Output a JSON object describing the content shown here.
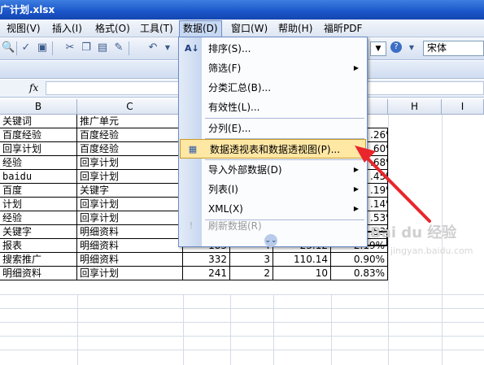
{
  "window": {
    "title": "广计划.xlsx"
  },
  "menubar": {
    "items": [
      {
        "label": "视图(V)",
        "name": "view"
      },
      {
        "label": "插入(I)",
        "name": "insert"
      },
      {
        "label": "格式(O)",
        "name": "format"
      },
      {
        "label": "工具(T)",
        "name": "tools"
      },
      {
        "label": "数据(D)",
        "name": "data"
      },
      {
        "label": "窗口(W)",
        "name": "window"
      },
      {
        "label": "帮助(H)",
        "name": "help"
      },
      {
        "label": "福昕PDF",
        "name": "foxit-pdf"
      }
    ]
  },
  "toolbar": {
    "font_name": "宋体"
  },
  "formula_bar": {
    "fx": "fx"
  },
  "sheet": {
    "columns": [
      "B",
      "C",
      "",
      "",
      "",
      "",
      "H",
      "I"
    ],
    "rows": [
      {
        "b": "关键词",
        "c": "推广单元",
        "d": "",
        "e": "",
        "f": "",
        "g": ""
      },
      {
        "b": "百度经验",
        "c": "百度经验",
        "d": "",
        "e": "",
        "f": "",
        "g": ".26%"
      },
      {
        "b": "回享计划",
        "c": "百度经验",
        "d": "",
        "e": "",
        "f": "",
        "g": ".60%"
      },
      {
        "b": "经验",
        "c": "回享计划",
        "d": "",
        "e": "",
        "f": "",
        "g": ".68%"
      },
      {
        "b": "baidu",
        "c": "回享计划",
        "d": "",
        "e": "",
        "f": "",
        "g": ".45%"
      },
      {
        "b": "百度",
        "c": "关键字",
        "d": "",
        "e": "",
        "f": "",
        "g": ".19%"
      },
      {
        "b": "计划",
        "c": "回享计划",
        "d": "",
        "e": "",
        "f": "",
        "g": ".14%"
      },
      {
        "b": "经验",
        "c": "回享计划",
        "d": "",
        "e": "",
        "f": "",
        "g": ".53%"
      },
      {
        "b": "关键字",
        "c": "明细资料",
        "d": "",
        "e": "",
        "f": "",
        "g": ".53%"
      },
      {
        "b": "报表",
        "c": "明细资料",
        "d": "183",
        "e": "4",
        "f": "23.12",
        "g": "2.19%"
      },
      {
        "b": "搜索推广",
        "c": "明细资料",
        "d": "332",
        "e": "3",
        "f": "110.14",
        "g": "0.90%"
      },
      {
        "b": "明细资料",
        "c": "回享计划",
        "d": "241",
        "e": "2",
        "f": "10",
        "g": "0.83%"
      }
    ]
  },
  "data_menu": {
    "items": [
      {
        "label": "排序(S)...",
        "has_submenu": false,
        "icon": "sort-az-icon"
      },
      {
        "label": "筛选(F)",
        "has_submenu": true,
        "icon": ""
      },
      {
        "label": "分类汇总(B)...",
        "has_submenu": false,
        "icon": ""
      },
      {
        "label": "有效性(L)...",
        "has_submenu": false,
        "icon": ""
      },
      {
        "label": "分列(E)...",
        "has_submenu": false,
        "icon": ""
      },
      {
        "label": "数据透视表和数据透视图(P)...",
        "has_submenu": false,
        "icon": "pivot-table-icon",
        "highlighted": true
      },
      {
        "label": "导入外部数据(D)",
        "has_submenu": true,
        "icon": ""
      },
      {
        "label": "列表(I)",
        "has_submenu": true,
        "icon": ""
      },
      {
        "label": "XML(X)",
        "has_submenu": true,
        "icon": ""
      },
      {
        "label": "刷新数据(R)",
        "has_submenu": false,
        "icon": "refresh-icon",
        "disabled": true
      }
    ]
  },
  "watermark": {
    "text": "Bai du 经验",
    "sub": "jingyan.baidu.com"
  },
  "colors": {
    "highlight": "#ffe7a4",
    "arrow": "#e8262c",
    "titlebar": "#1a55c9"
  }
}
